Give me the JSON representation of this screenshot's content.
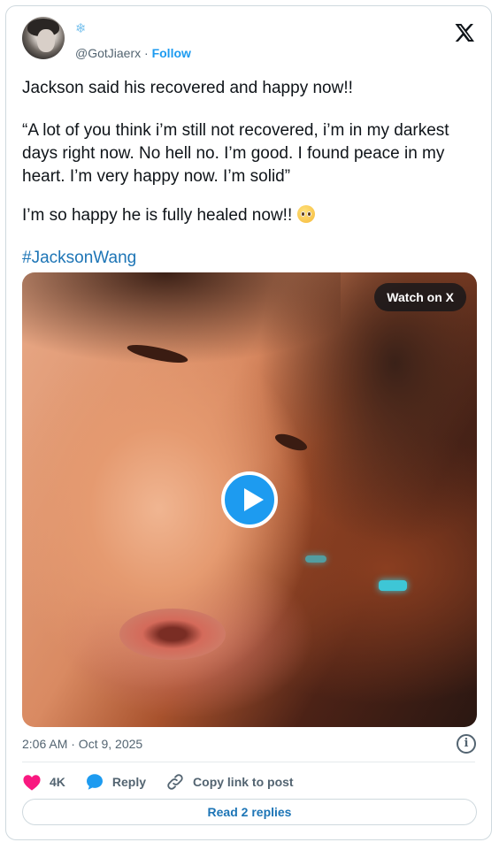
{
  "user": {
    "display_emoji": "❄",
    "handle": "@GotJiaerx",
    "separator": "·",
    "follow_label": "Follow"
  },
  "tweet": {
    "line1": "Jackson said his recovered and happy now!!",
    "quote": "“A lot of you think i’m still not recovered, i’m in my darkest days right now. No hell no. I’m good. I found peace in my heart. I’m very happy now. I’m solid”",
    "line3": "I’m so happy he is fully healed now!!",
    "line3_emoji": "pleading-face-emoji",
    "hashtag": "#JacksonWang"
  },
  "media": {
    "watch_label": "Watch on X",
    "play_icon": "play-icon"
  },
  "meta": {
    "timestamp": "2:06 AM · Oct 9, 2025",
    "info_icon": "info-icon"
  },
  "actions": {
    "like_count": "4K",
    "reply_label": "Reply",
    "copy_label": "Copy link to post"
  },
  "read_replies_label": "Read 2 replies",
  "colors": {
    "accent": "#1d9bf0",
    "link": "#1d75b6",
    "heart": "#f91880",
    "secondary_text": "#536471"
  }
}
